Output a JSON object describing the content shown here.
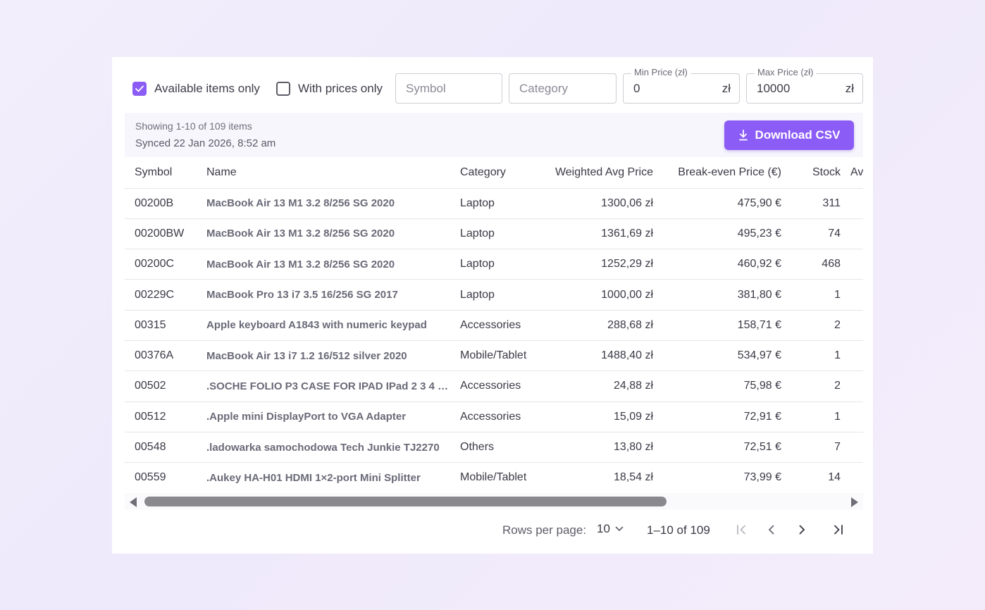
{
  "filters": {
    "available_only": {
      "label": "Available items only",
      "checked": true
    },
    "with_prices_only": {
      "label": "With prices only",
      "checked": false
    },
    "symbol": {
      "placeholder": "Symbol",
      "value": ""
    },
    "category": {
      "placeholder": "Category",
      "value": ""
    },
    "min_price": {
      "label": "Min Price (zł)",
      "value": "0",
      "unit": "zł"
    },
    "max_price": {
      "label": "Max Price (zł)",
      "value": "10000",
      "unit": "zł"
    }
  },
  "info": {
    "showing": "Showing 1-10 of 109 items",
    "synced": "Synced 22 Jan 2026, 8:52 am",
    "download_label": "Download CSV"
  },
  "table": {
    "columns": [
      "Symbol",
      "Name",
      "Category",
      "Weighted Avg Price",
      "Break-even Price (€)",
      "Stock",
      "Av"
    ],
    "rows": [
      {
        "symbol": "00200B",
        "name": "MacBook Air 13 M1 3.2 8/256 SG 2020",
        "category": "Laptop",
        "avg_price": "1300,06 zł",
        "breakeven": "475,90 €",
        "stock": "311"
      },
      {
        "symbol": "00200BW",
        "name": "MacBook Air 13 M1 3.2 8/256 SG 2020",
        "category": "Laptop",
        "avg_price": "1361,69 zł",
        "breakeven": "495,23 €",
        "stock": "74"
      },
      {
        "symbol": "00200C",
        "name": "MacBook Air 13 M1 3.2 8/256 SG 2020",
        "category": "Laptop",
        "avg_price": "1252,29 zł",
        "breakeven": "460,92 €",
        "stock": "468"
      },
      {
        "symbol": "00229C",
        "name": "MacBook Pro 13 i7 3.5 16/256 SG 2017",
        "category": "Laptop",
        "avg_price": "1000,00 zł",
        "breakeven": "381,80 €",
        "stock": "1"
      },
      {
        "symbol": "00315",
        "name": "Apple keyboard A1843 with numeric keypad",
        "category": "Accessories",
        "avg_price": "288,68 zł",
        "breakeven": "158,71 €",
        "stock": "2"
      },
      {
        "symbol": "00376A",
        "name": "MacBook Air 13 i7 1.2 16/512 silver 2020",
        "category": "Mobile/Tablet",
        "avg_price": "1488,40 zł",
        "breakeven": "534,97 €",
        "stock": "1"
      },
      {
        "symbol": "00502",
        "name": ".SOCHE FOLIO P3 CASE FOR IPAD IPad 2 3 4 …",
        "category": "Accessories",
        "avg_price": "24,88 zł",
        "breakeven": "75,98 €",
        "stock": "2"
      },
      {
        "symbol": "00512",
        "name": ".Apple mini DisplayPort to VGA Adapter",
        "category": "Accessories",
        "avg_price": "15,09 zł",
        "breakeven": "72,91 €",
        "stock": "1"
      },
      {
        "symbol": "00548",
        "name": ".ladowarka samochodowa Tech Junkie TJ2270",
        "category": "Others",
        "avg_price": "13,80 zł",
        "breakeven": "72,51 €",
        "stock": "7"
      },
      {
        "symbol": "00559",
        "name": ".Aukey HA-H01 HDMI 1×2-port Mini Splitter",
        "category": "Mobile/Tablet",
        "avg_price": "18,54 zł",
        "breakeven": "73,99 €",
        "stock": "14"
      }
    ]
  },
  "pagination": {
    "rows_per_page_label": "Rows per page:",
    "rows_per_page": "10",
    "range": "1–10 of 109"
  },
  "colors": {
    "accent": "#8b5cf6",
    "text": "#3a3a46",
    "muted": "#6a6a78"
  },
  "icons": [
    "check-icon",
    "download-icon",
    "chevron-down-icon",
    "first-page-icon",
    "prev-page-icon",
    "next-page-icon",
    "last-page-icon",
    "scroll-left-arrow-icon",
    "scroll-right-arrow-icon"
  ]
}
